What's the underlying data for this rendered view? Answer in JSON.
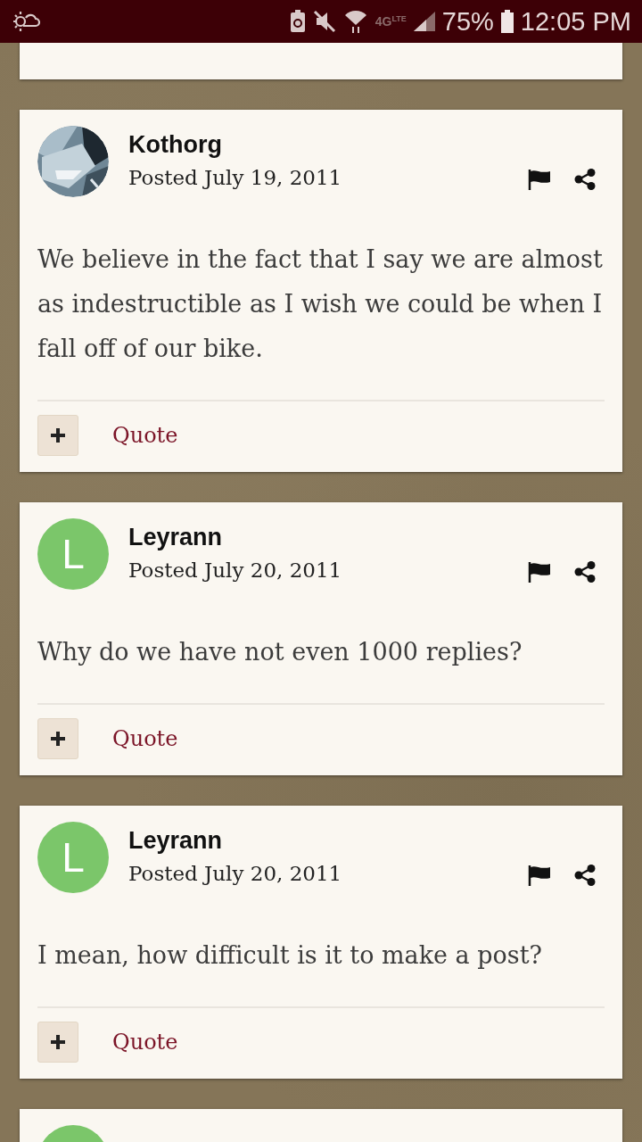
{
  "status_bar": {
    "network": "4G",
    "network_sub": "LTE",
    "battery": "75%",
    "time": "12:05 PM"
  },
  "posts": [
    {
      "kind": "end_only"
    },
    {
      "kind": "full",
      "author": "Kothorg",
      "date": "Posted July 19, 2011",
      "body": "We believe in the fact that I say we are almost as indestructible as I wish we could be when I fall off of our bike.",
      "quote_label": "Quote"
    },
    {
      "kind": "full",
      "author": "Leyrann",
      "date": "Posted July 20, 2011",
      "avatar": {
        "kind": "letter",
        "letter": "L",
        "color": "#7bc66a"
      },
      "body": "Why do we have not even 1000 replies?",
      "quote_label": "Quote"
    },
    {
      "kind": "full",
      "author": "Leyrann",
      "date": "Posted July 20, 2011",
      "avatar": {
        "kind": "letter",
        "letter": "L",
        "color": "#7bc66a"
      },
      "body": "I mean, how difficult is it to make a post?",
      "quote_label": "Quote"
    },
    {
      "kind": "header_only",
      "avatar": {
        "kind": "letter",
        "color": "#7bc66a"
      }
    }
  ]
}
